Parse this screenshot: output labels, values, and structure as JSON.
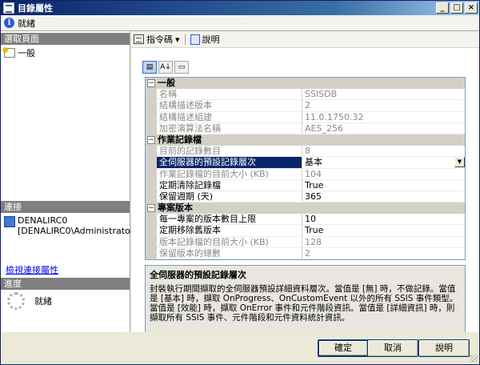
{
  "window": {
    "title": "目錄屬性"
  },
  "status": {
    "text": "就緒"
  },
  "left": {
    "pages_header": "選取頁面",
    "pages": [
      {
        "label": "一般"
      }
    ],
    "connection_header": "連接",
    "connection_server": "DENALIRC0",
    "connection_user": "[DENALIRC0\\Administrator]",
    "view_connection_link": "檢視連接屬性",
    "progress_header": "進度",
    "progress_text": "就緒"
  },
  "toolbar": {
    "script_label": "指令碼",
    "script_dropdown": "▾",
    "help_label": "說明"
  },
  "grid_toolbar": {
    "categorized": "▤",
    "alphabetical": "A↓",
    "pages": "▭"
  },
  "properties": {
    "general": {
      "label": "一般",
      "rows": [
        {
          "name": "名稱",
          "value": "SSISDB"
        },
        {
          "name": "結構描述版本",
          "value": "2"
        },
        {
          "name": "結構描述組建",
          "value": "11.0.1750.32"
        },
        {
          "name": "加密演算法名稱",
          "value": "AES_256"
        }
      ]
    },
    "logging": {
      "label": "作業記錄檔",
      "rows": [
        {
          "name": "目前的記錄數目",
          "value": "8"
        },
        {
          "name": "全伺服器的預設記錄層次",
          "value": "基本"
        },
        {
          "name": "作業記錄檔的目前大小 (KB)",
          "value": "104"
        },
        {
          "name": "定期清除記錄檔",
          "value": "True"
        },
        {
          "name": "保留週期 (天)",
          "value": "365"
        }
      ]
    },
    "versions": {
      "label": "專案版本",
      "rows": [
        {
          "name": "每一專案的版本數目上限",
          "value": "10"
        },
        {
          "name": "定期移除舊版本",
          "value": "True"
        },
        {
          "name": "版本記錄檔的目前大小 (KB)",
          "value": "128"
        },
        {
          "name": "保留版本的總數",
          "value": "2"
        }
      ]
    }
  },
  "description": {
    "title": "全伺服器的預設記錄層次",
    "text": "封裝執行期間擷取的全伺服器預設詳細資料層次。當值是 [無] 時，不做記錄。當值是 [基本] 時，擷取 OnProgress、OnCustomEvent 以外的所有 SSIS 事件類型。當值是 [效能] 時，擷取 OnError 事件和元件階段資訊。當值是 [詳細資訊] 時，則擷取所有 SSIS 事件、元件階段和元件資料統計資訊。"
  },
  "buttons": {
    "ok": "確定",
    "cancel": "取消",
    "help": "說明"
  },
  "window_controls": {
    "minimize": "_",
    "maximize": "□",
    "close": "×"
  }
}
